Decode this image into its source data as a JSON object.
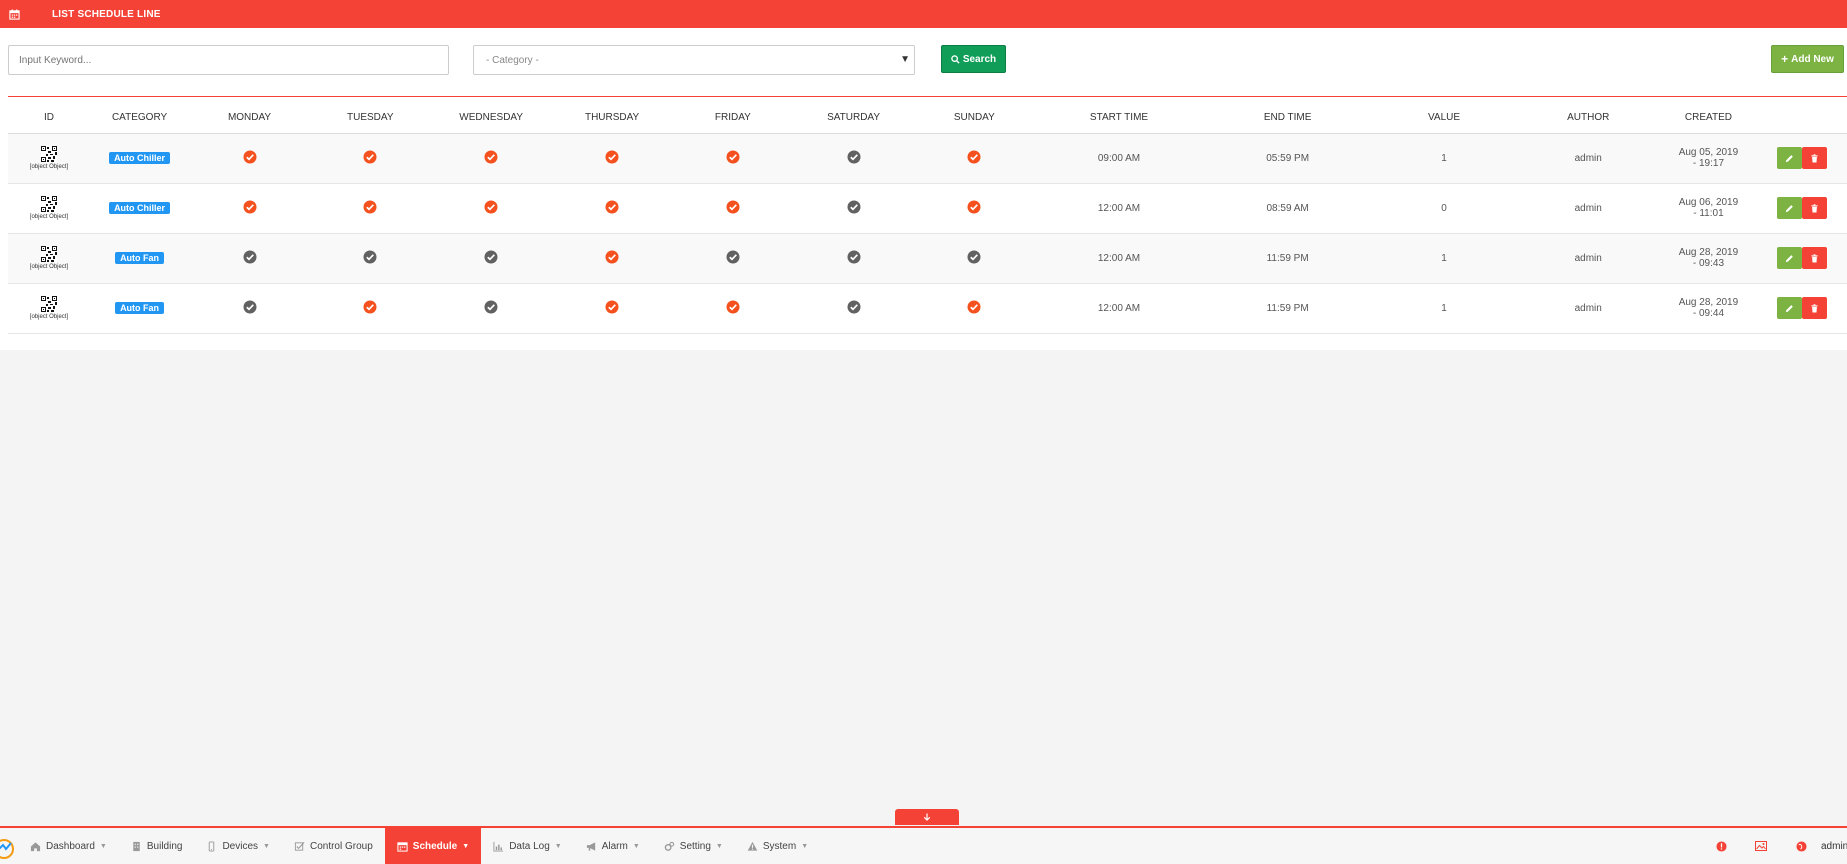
{
  "header": {
    "title": "LIST SCHEDULE LINE",
    "icon": "calendar-icon"
  },
  "filters": {
    "keyword_placeholder": "Input Keyword...",
    "category_selected": "- Category -",
    "search_label": "Search",
    "add_label": "Add New"
  },
  "table": {
    "columns": [
      "ID",
      "CATEGORY",
      "MONDAY",
      "TUESDAY",
      "WEDNESDAY",
      "THURSDAY",
      "FRIDAY",
      "SATURDAY",
      "SUNDAY",
      "START TIME",
      "END TIME",
      "VALUE",
      "AUTHOR",
      "CREATED"
    ],
    "rows": [
      {
        "id_caption": "[object Object]",
        "category": "Auto Chiller",
        "days": [
          true,
          true,
          true,
          true,
          true,
          false,
          true
        ],
        "start_time": "09:00 AM",
        "end_time": "05:59 PM",
        "value": "1",
        "author": "admin",
        "created_date": "Aug 05, 2019",
        "created_time": "- 19:17"
      },
      {
        "id_caption": "[object Object]",
        "category": "Auto Chiller",
        "days": [
          true,
          true,
          true,
          true,
          true,
          false,
          true
        ],
        "start_time": "12:00 AM",
        "end_time": "08:59 AM",
        "value": "0",
        "author": "admin",
        "created_date": "Aug 06, 2019",
        "created_time": "- 11:01"
      },
      {
        "id_caption": "[object Object]",
        "category": "Auto Fan",
        "days": [
          false,
          false,
          false,
          true,
          false,
          false,
          false
        ],
        "start_time": "12:00 AM",
        "end_time": "11:59 PM",
        "value": "1",
        "author": "admin",
        "created_date": "Aug 28, 2019",
        "created_time": "- 09:43"
      },
      {
        "id_caption": "[object Object]",
        "category": "Auto Fan",
        "days": [
          false,
          true,
          false,
          true,
          true,
          false,
          true
        ],
        "start_time": "12:00 AM",
        "end_time": "11:59 PM",
        "value": "1",
        "author": "admin",
        "created_date": "Aug 28, 2019",
        "created_time": "- 09:44"
      }
    ]
  },
  "nav": {
    "items": [
      {
        "label": "Dashboard",
        "icon": "home-icon",
        "dropdown": true,
        "active": false
      },
      {
        "label": "Building",
        "icon": "building-icon",
        "dropdown": false,
        "active": false
      },
      {
        "label": "Devices",
        "icon": "device-icon",
        "dropdown": true,
        "active": false
      },
      {
        "label": "Control Group",
        "icon": "checkbox-icon",
        "dropdown": false,
        "active": false
      },
      {
        "label": "Schedule",
        "icon": "calendar-icon",
        "dropdown": true,
        "active": true
      },
      {
        "label": "Data Log",
        "icon": "chart-icon",
        "dropdown": true,
        "active": false
      },
      {
        "label": "Alarm",
        "icon": "bullhorn-icon",
        "dropdown": true,
        "active": false
      },
      {
        "label": "Setting",
        "icon": "cogs-icon",
        "dropdown": true,
        "active": false
      },
      {
        "label": "System",
        "icon": "warning-icon",
        "dropdown": true,
        "active": false
      }
    ],
    "username": "admin"
  },
  "colors": {
    "primary_red": "#f44336",
    "check_on": "#f4511e",
    "check_off": "#616161",
    "badge_blue": "#2196f3",
    "green": "#0f9d58",
    "light_green": "#7cb342"
  }
}
